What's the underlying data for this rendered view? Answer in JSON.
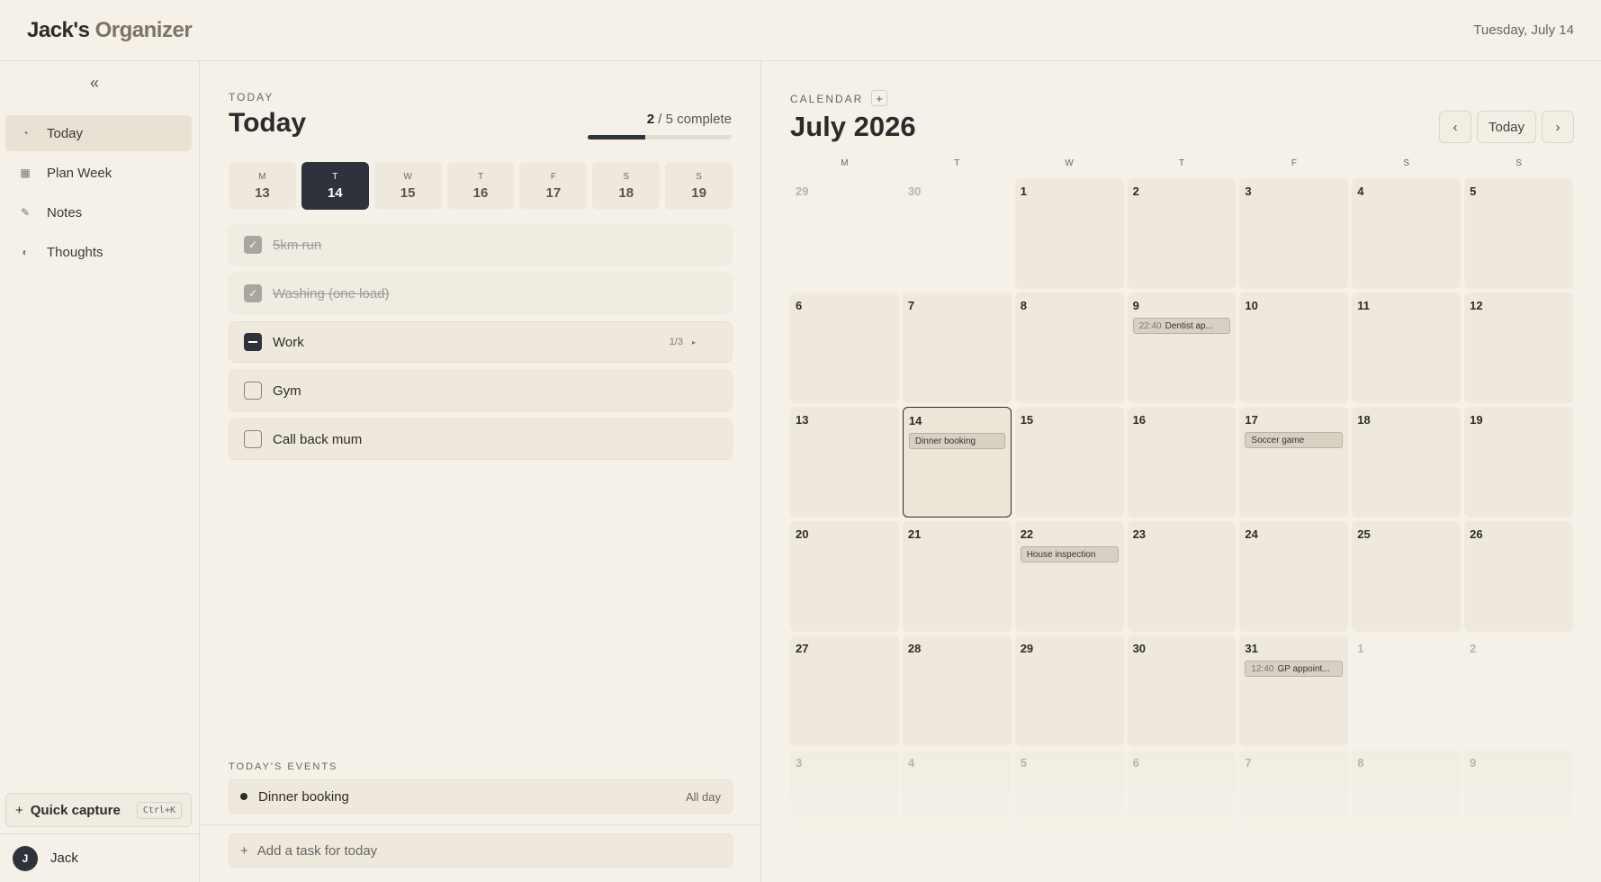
{
  "app": {
    "brand_part1": "Jack's",
    "brand_part2": "Organizer",
    "date": "Tuesday, July 14"
  },
  "sidebar": {
    "collapse_icon": "«",
    "items": [
      {
        "label": "Today",
        "icon": "clock-icon",
        "active": true
      },
      {
        "label": "Plan Week",
        "icon": "grid-icon",
        "active": false
      },
      {
        "label": "Notes",
        "icon": "pencil-icon",
        "active": false
      },
      {
        "label": "Thoughts",
        "icon": "half-circle-icon",
        "active": false
      }
    ],
    "quick_capture": {
      "label": "Quick capture",
      "shortcut": "Ctrl+K"
    },
    "user": {
      "initial": "J",
      "name": "Jack"
    }
  },
  "today": {
    "eyebrow": "TODAY",
    "title": "Today",
    "progress": {
      "done": "2",
      "total_text": "/ 5 complete",
      "fraction": 0.4
    },
    "week": [
      {
        "letter": "M",
        "num": "13",
        "selected": false
      },
      {
        "letter": "T",
        "num": "14",
        "selected": true
      },
      {
        "letter": "W",
        "num": "15",
        "selected": false
      },
      {
        "letter": "T",
        "num": "16",
        "selected": false
      },
      {
        "letter": "F",
        "num": "17",
        "selected": false
      },
      {
        "letter": "S",
        "num": "18",
        "selected": false
      },
      {
        "letter": "S",
        "num": "19",
        "selected": false
      }
    ],
    "tasks": [
      {
        "label": "5km run",
        "state": "done"
      },
      {
        "label": "Washing (one load)",
        "state": "done"
      },
      {
        "label": "Work",
        "state": "partial",
        "subtasks": "1/3"
      },
      {
        "label": "Gym",
        "state": "open"
      },
      {
        "label": "Call back mum",
        "state": "open"
      }
    ],
    "events_eyebrow": "TODAY'S EVENTS",
    "event": {
      "label": "Dinner booking",
      "time": "All day"
    },
    "add_task_placeholder": "Add a task for today"
  },
  "calendar": {
    "eyebrow": "CALENDAR",
    "add_icon": "+",
    "title": "July 2026",
    "prev_icon": "‹",
    "today_label": "Today",
    "next_icon": "›",
    "weekdays": [
      "M",
      "T",
      "W",
      "T",
      "F",
      "S",
      "S"
    ],
    "weeks": [
      [
        {
          "n": "29",
          "out": true
        },
        {
          "n": "30",
          "out": true
        },
        {
          "n": "1"
        },
        {
          "n": "2"
        },
        {
          "n": "3"
        },
        {
          "n": "4"
        },
        {
          "n": "5"
        }
      ],
      [
        {
          "n": "6"
        },
        {
          "n": "7"
        },
        {
          "n": "8"
        },
        {
          "n": "9",
          "event": {
            "time": "22:40",
            "label": "Dentist ap..."
          }
        },
        {
          "n": "10"
        },
        {
          "n": "11"
        },
        {
          "n": "12"
        }
      ],
      [
        {
          "n": "13"
        },
        {
          "n": "14",
          "today": true,
          "event": {
            "label": "Dinner booking"
          }
        },
        {
          "n": "15"
        },
        {
          "n": "16"
        },
        {
          "n": "17",
          "event": {
            "label": "Soccer game"
          }
        },
        {
          "n": "18"
        },
        {
          "n": "19"
        }
      ],
      [
        {
          "n": "20"
        },
        {
          "n": "21"
        },
        {
          "n": "22",
          "event": {
            "label": "House inspection"
          }
        },
        {
          "n": "23"
        },
        {
          "n": "24"
        },
        {
          "n": "25"
        },
        {
          "n": "26"
        }
      ],
      [
        {
          "n": "27"
        },
        {
          "n": "28"
        },
        {
          "n": "29"
        },
        {
          "n": "30"
        },
        {
          "n": "31",
          "event": {
            "time": "12:40",
            "label": "GP appoint..."
          }
        },
        {
          "n": "1",
          "out": true
        },
        {
          "n": "2",
          "out": true
        }
      ],
      [
        {
          "n": "3",
          "out": true,
          "last": true
        },
        {
          "n": "4",
          "out": true,
          "last": true
        },
        {
          "n": "5",
          "out": true,
          "last": true
        },
        {
          "n": "6",
          "out": true,
          "last": true
        },
        {
          "n": "7",
          "out": true,
          "last": true
        },
        {
          "n": "8",
          "out": true,
          "last": true
        },
        {
          "n": "9",
          "out": true,
          "last": true
        }
      ]
    ]
  }
}
